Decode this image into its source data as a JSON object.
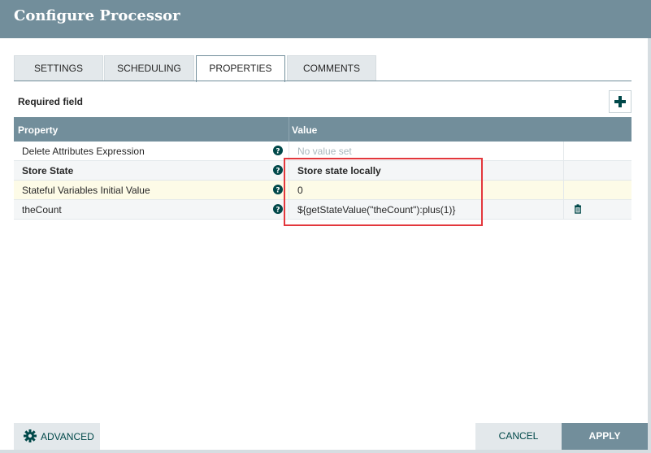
{
  "dialog": {
    "title": "Configure Processor"
  },
  "tabs": [
    {
      "label": "SETTINGS",
      "active": false
    },
    {
      "label": "SCHEDULING",
      "active": false
    },
    {
      "label": "PROPERTIES",
      "active": true
    },
    {
      "label": "COMMENTS",
      "active": false
    }
  ],
  "properties": {
    "required_label": "Required field",
    "add_icon": "plus-icon",
    "columns": {
      "property": "Property",
      "value": "Value"
    },
    "rows": [
      {
        "name": "Delete Attributes Expression",
        "value": "No value set",
        "bold": false,
        "unset": true,
        "deletable": false
      },
      {
        "name": "Store State",
        "value": "Store state locally",
        "bold": true,
        "unset": false,
        "deletable": false
      },
      {
        "name": "Stateful Variables Initial Value",
        "value": "0",
        "bold": false,
        "unset": false,
        "deletable": false
      },
      {
        "name": "theCount",
        "value": "${getStateValue(\"theCount\"):plus(1)}",
        "bold": false,
        "unset": false,
        "deletable": true
      }
    ]
  },
  "footer": {
    "advanced_label": "ADVANCED",
    "advanced_icon": "gear-icon",
    "cancel_label": "CANCEL",
    "apply_label": "APPLY"
  },
  "colors": {
    "header": "#728e9b",
    "accent_text": "#004849",
    "annotation": "#e3373c",
    "highlight_row": "#fdfbe7"
  }
}
